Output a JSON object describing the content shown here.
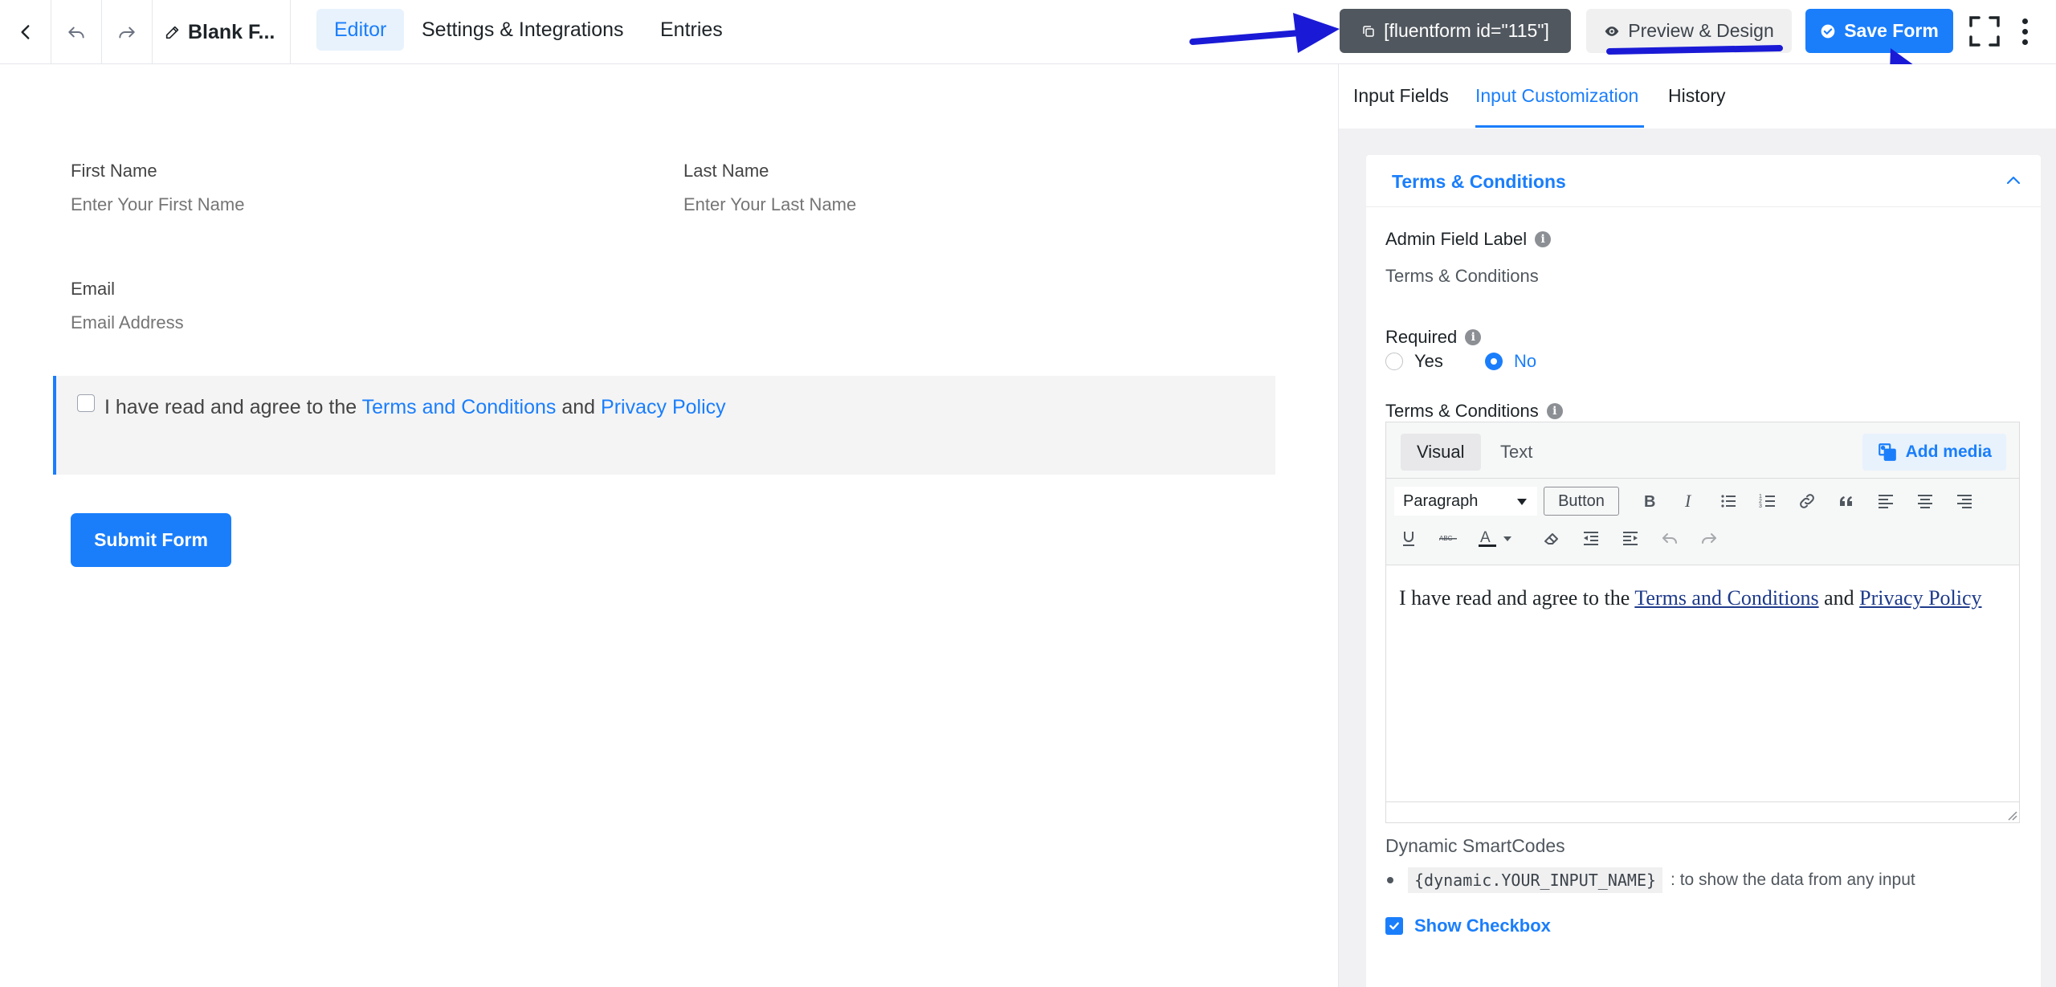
{
  "topbar": {
    "form_title": "Blank F...",
    "tabs": [
      "Editor",
      "Settings & Integrations",
      "Entries"
    ],
    "active_tab": "Editor",
    "shortcode": "[fluentform id=\"115\"]",
    "preview_label": "Preview & Design",
    "save_label": "Save Form"
  },
  "form": {
    "first_name_label": "First Name",
    "first_name_placeholder": "Enter Your First Name",
    "last_name_label": "Last Name",
    "last_name_placeholder": "Enter Your Last Name",
    "email_label": "Email",
    "email_placeholder": "Email Address",
    "terms_prefix": "I have read and agree to the",
    "terms_link": "Terms and Conditions",
    "terms_and": "and",
    "privacy_link": "Privacy Policy",
    "submit_label": "Submit Form"
  },
  "panel": {
    "tabs": [
      "Input Fields",
      "Input Customization",
      "History"
    ],
    "active_tab": "Input Customization",
    "card_title": "Terms & Conditions",
    "admin_label_title": "Admin Field Label",
    "admin_label_value": "Terms & Conditions",
    "required_title": "Required",
    "required_options": [
      "Yes",
      "No"
    ],
    "required_selected": "No",
    "terms_title": "Terms & Conditions",
    "editor": {
      "tab_visual": "Visual",
      "tab_text": "Text",
      "add_media": "Add media",
      "format_select": "Paragraph",
      "button_label": "Button",
      "strike_label": "ABC",
      "content_prefix": "I have read and agree to the",
      "content_link1": "Terms and Conditions",
      "content_and": "and",
      "content_link2": "Privacy Policy"
    },
    "smartcodes_title": "Dynamic SmartCodes",
    "smartcode": "{dynamic.YOUR_INPUT_NAME}",
    "smartcode_desc": ": to show the data from any input",
    "show_checkbox_label": "Show Checkbox"
  },
  "colors": {
    "accent": "#1a7efb",
    "annotation": "#1a1ad6",
    "shortcode_bg": "#50575e"
  }
}
